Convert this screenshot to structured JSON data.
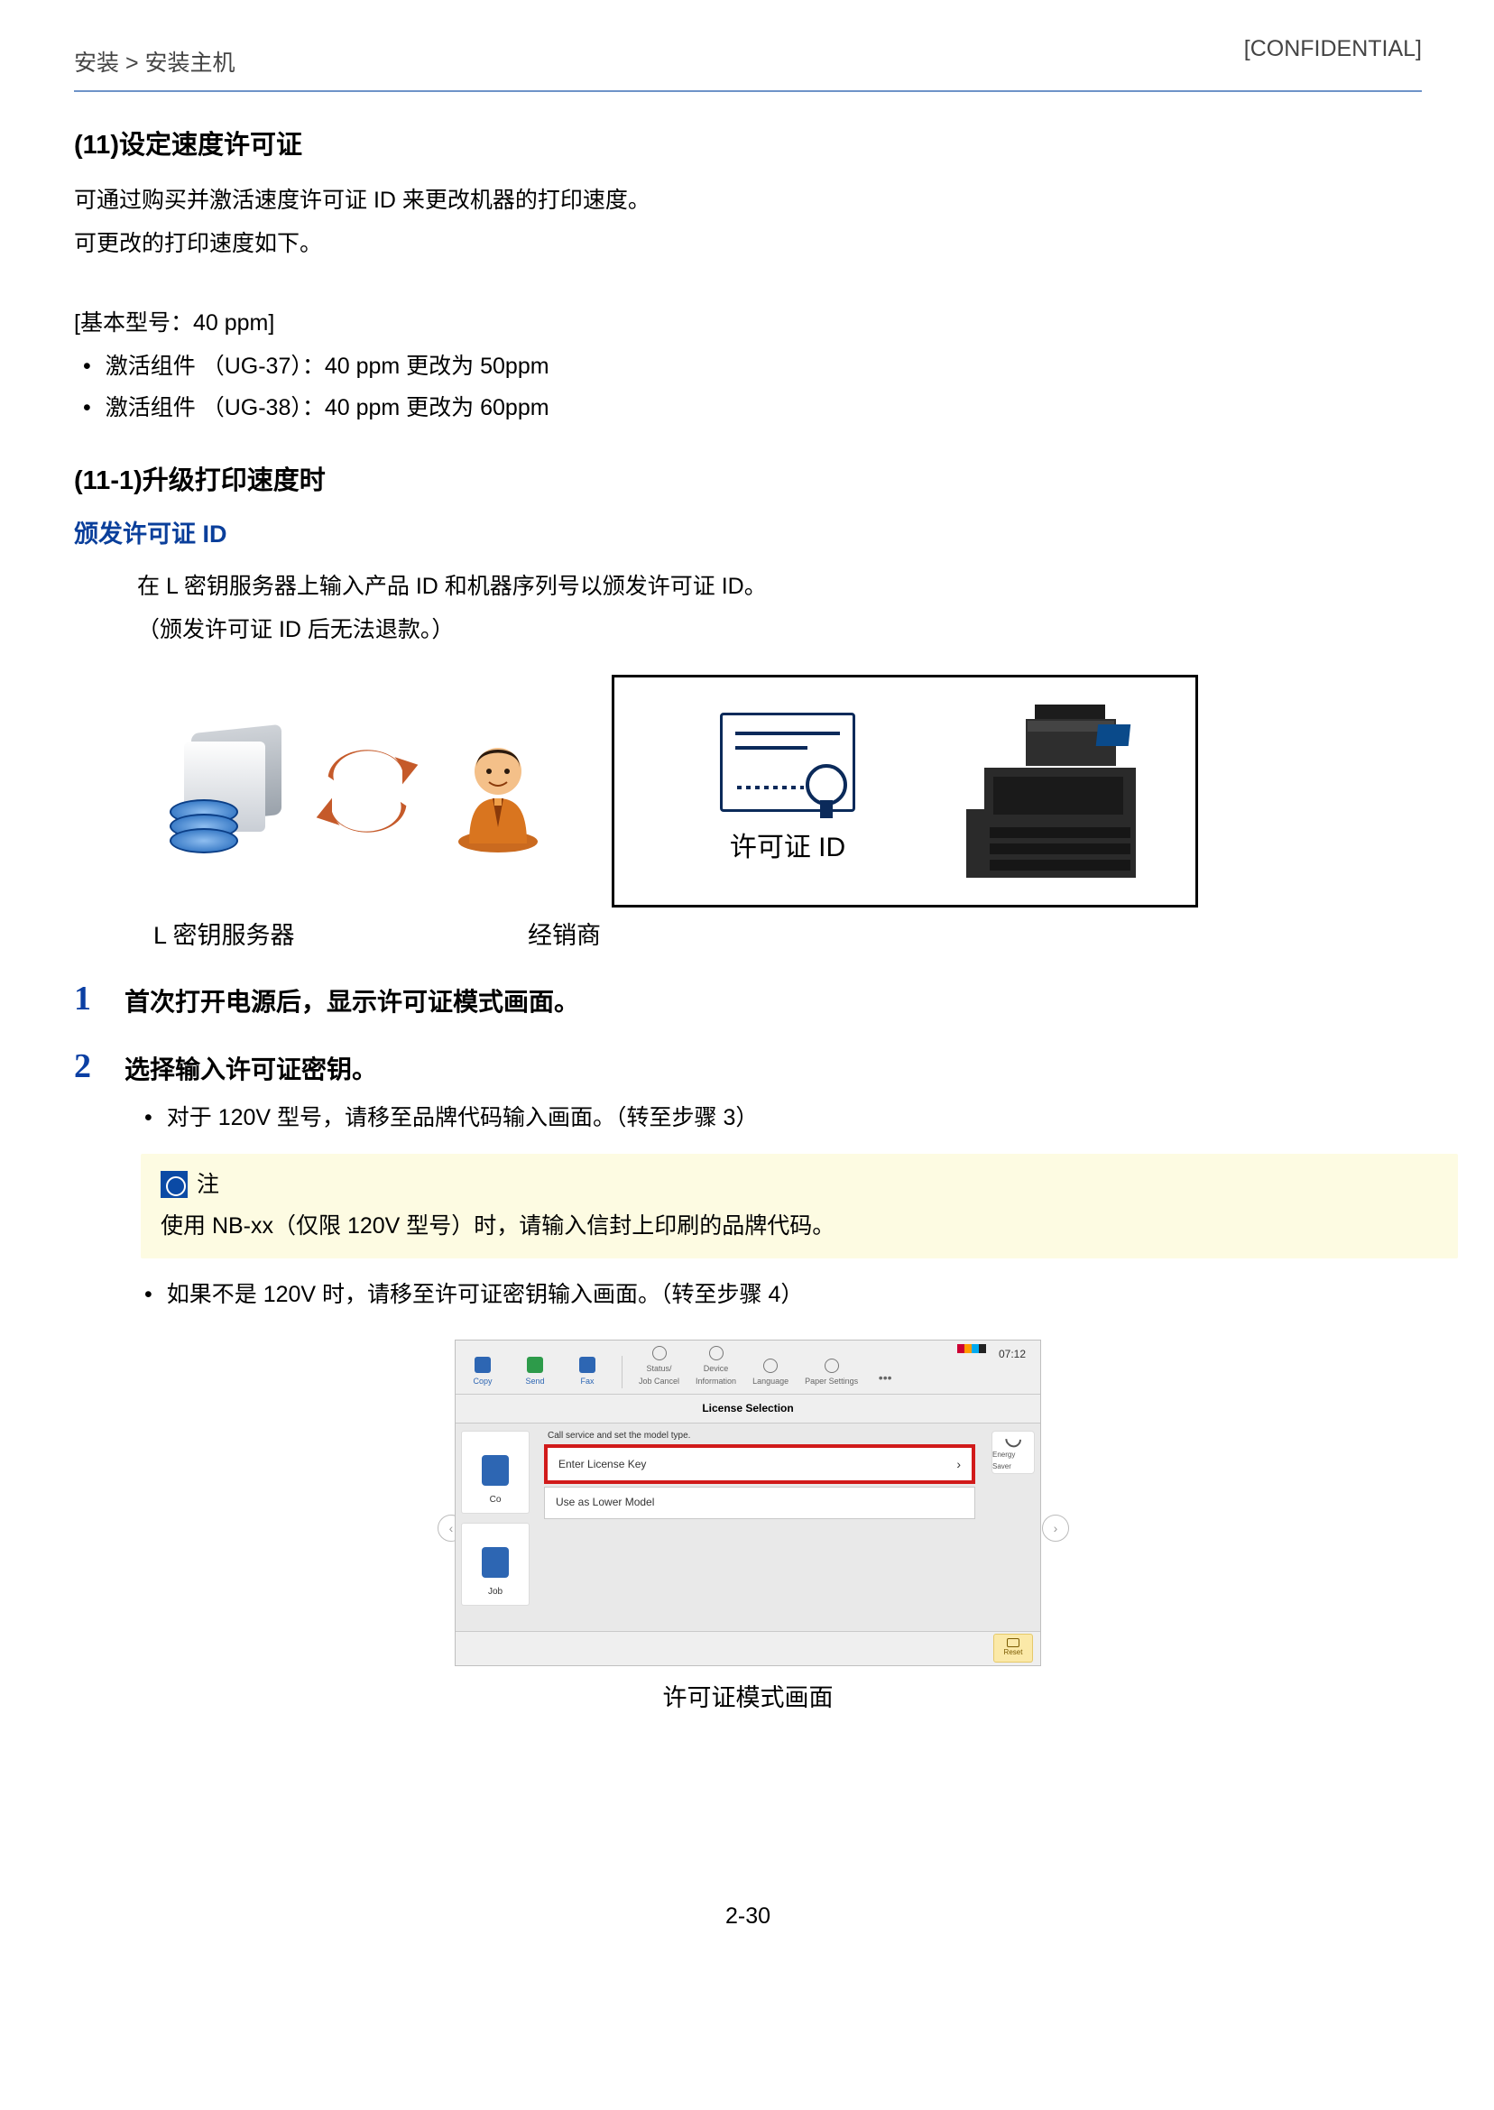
{
  "header": {
    "breadcrumb": "安装 > 安装主机",
    "confidential": "[CONFIDENTIAL]"
  },
  "section11": {
    "title": "(11)设定速度许可证",
    "p1": "可通过购买并激活速度许可证 ID 来更改机器的打印速度。",
    "p2": "可更改的打印速度如下。",
    "model_line": "[基本型号：40 ppm]",
    "bul1": "激活组件 （UG-37）：40 ppm 更改为 50ppm",
    "bul2": "激活组件 （UG-38）：40 ppm 更改为 60ppm"
  },
  "section11_1": {
    "title": "(11-1)升级打印速度时",
    "issue_title": "颁发许可证 ID",
    "issue_line1": "在 L 密钥服务器上输入产品 ID 和机器序列号以颁发许可证 ID。",
    "issue_line2": "（颁发许可证 ID 后无法退款。）",
    "server_label": "L 密钥服务器",
    "dealer_label": "经销商",
    "license_label": "许可证 ID"
  },
  "steps": {
    "s1_num": "1",
    "s1_text": "首次打开电源后，显示许可证模式画面。",
    "s2_num": "2",
    "s2_text": "选择输入许可证密钥。",
    "s2_sub1": "对于 120V 型号，请移至品牌代码输入画面。（转至步骤 3）",
    "s2_sub2": "如果不是 120V 时，请移至许可证密钥输入画面。（转至步骤 4）"
  },
  "note": {
    "title": "注",
    "body": "使用 NB-xx（仅限 120V 型号）时，请输入信封上印刷的品牌代码。"
  },
  "screenshot": {
    "time": "07:12",
    "tb_copy": "Copy",
    "tb_send": "Send",
    "tb_fax": "Fax",
    "tb_status": "Status/\nJob Cancel",
    "tb_device": "Device\nInformation",
    "tb_lang": "Language",
    "tb_paper": "Paper Settings",
    "tb_more": "•••",
    "section_title": "License Selection",
    "hint": "Call service and set the model type.",
    "opt_enter": "Enter License Key",
    "opt_lower": "Use as Lower Model",
    "left_card1": "Co",
    "left_card2": "Job",
    "energy": "Energy Saver",
    "reset": "Reset",
    "caption": "许可证模式画面"
  },
  "page_number": "2-30"
}
